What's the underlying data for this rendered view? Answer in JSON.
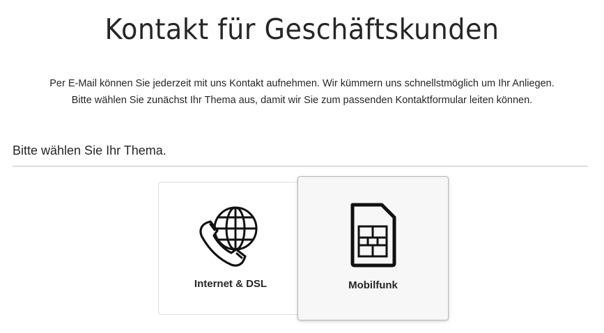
{
  "page": {
    "title": "Kontakt für Geschäftskunden",
    "intro_line1": "Per E-Mail können Sie jederzeit mit uns Kontakt aufnehmen. Wir kümmern uns schnellstmöglich um Ihr Anliegen.",
    "intro_line2": "Bitte wählen Sie zunächst Ihr Thema aus, damit wir Sie zum passenden Kontaktformular leiten können."
  },
  "topic_section": {
    "heading": "Bitte wählen Sie Ihr Thema.",
    "options": [
      {
        "label": "Internet & DSL",
        "icon": "phone-globe-icon",
        "selected": false
      },
      {
        "label": "Mobilfunk",
        "icon": "sim-card-icon",
        "selected": true
      }
    ]
  },
  "colors": {
    "text": "#262626",
    "divider": "#bfbfbf",
    "card_border": "#dcdcdc",
    "card_hover_bg": "#f7f7f7"
  }
}
